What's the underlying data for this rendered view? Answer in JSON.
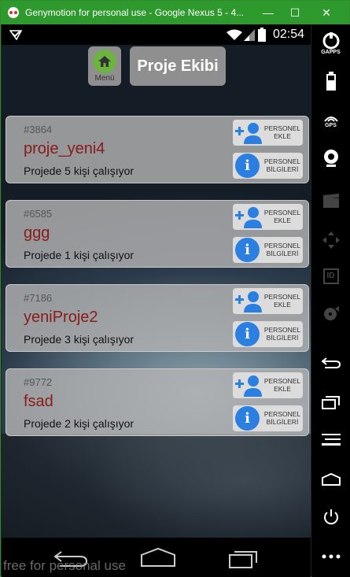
{
  "window": {
    "title": "Genymotion for personal use - Google Nexus 5 - 4...",
    "minimize": "—",
    "maximize": "☐",
    "close": "✕"
  },
  "statusbar": {
    "time": "02:54"
  },
  "header": {
    "menu_label": "Menü",
    "title": "Proje Ekibi"
  },
  "projects": [
    {
      "id": "#3864",
      "name": "proje_yeni4",
      "count": "Projede 5 kişi çalışıyor"
    },
    {
      "id": "#6585",
      "name": "ggg",
      "count": "Projede 1 kişi çalışıyor"
    },
    {
      "id": "#7186",
      "name": "yeniProje2",
      "count": "Projede 3 kişi çalışıyor"
    },
    {
      "id": "#9772",
      "name": "fsad",
      "count": "Projede 2 kişi çalışıyor"
    }
  ],
  "actions": {
    "add_line1": "PERSONEL",
    "add_line2": "EKLE",
    "info_line1": "PERSONEL",
    "info_line2": "BİLGİLERİ"
  },
  "watermark": "free for personal use",
  "sidebar": {
    "gaps_label": "GAPPS",
    "gps_label": "GPS",
    "id_label": "ID"
  },
  "colors": {
    "titlebar": "#2e9a2e",
    "project_name": "#8b1a1a",
    "icon_blue": "#2a7fe0",
    "home_green": "#6db33f"
  }
}
